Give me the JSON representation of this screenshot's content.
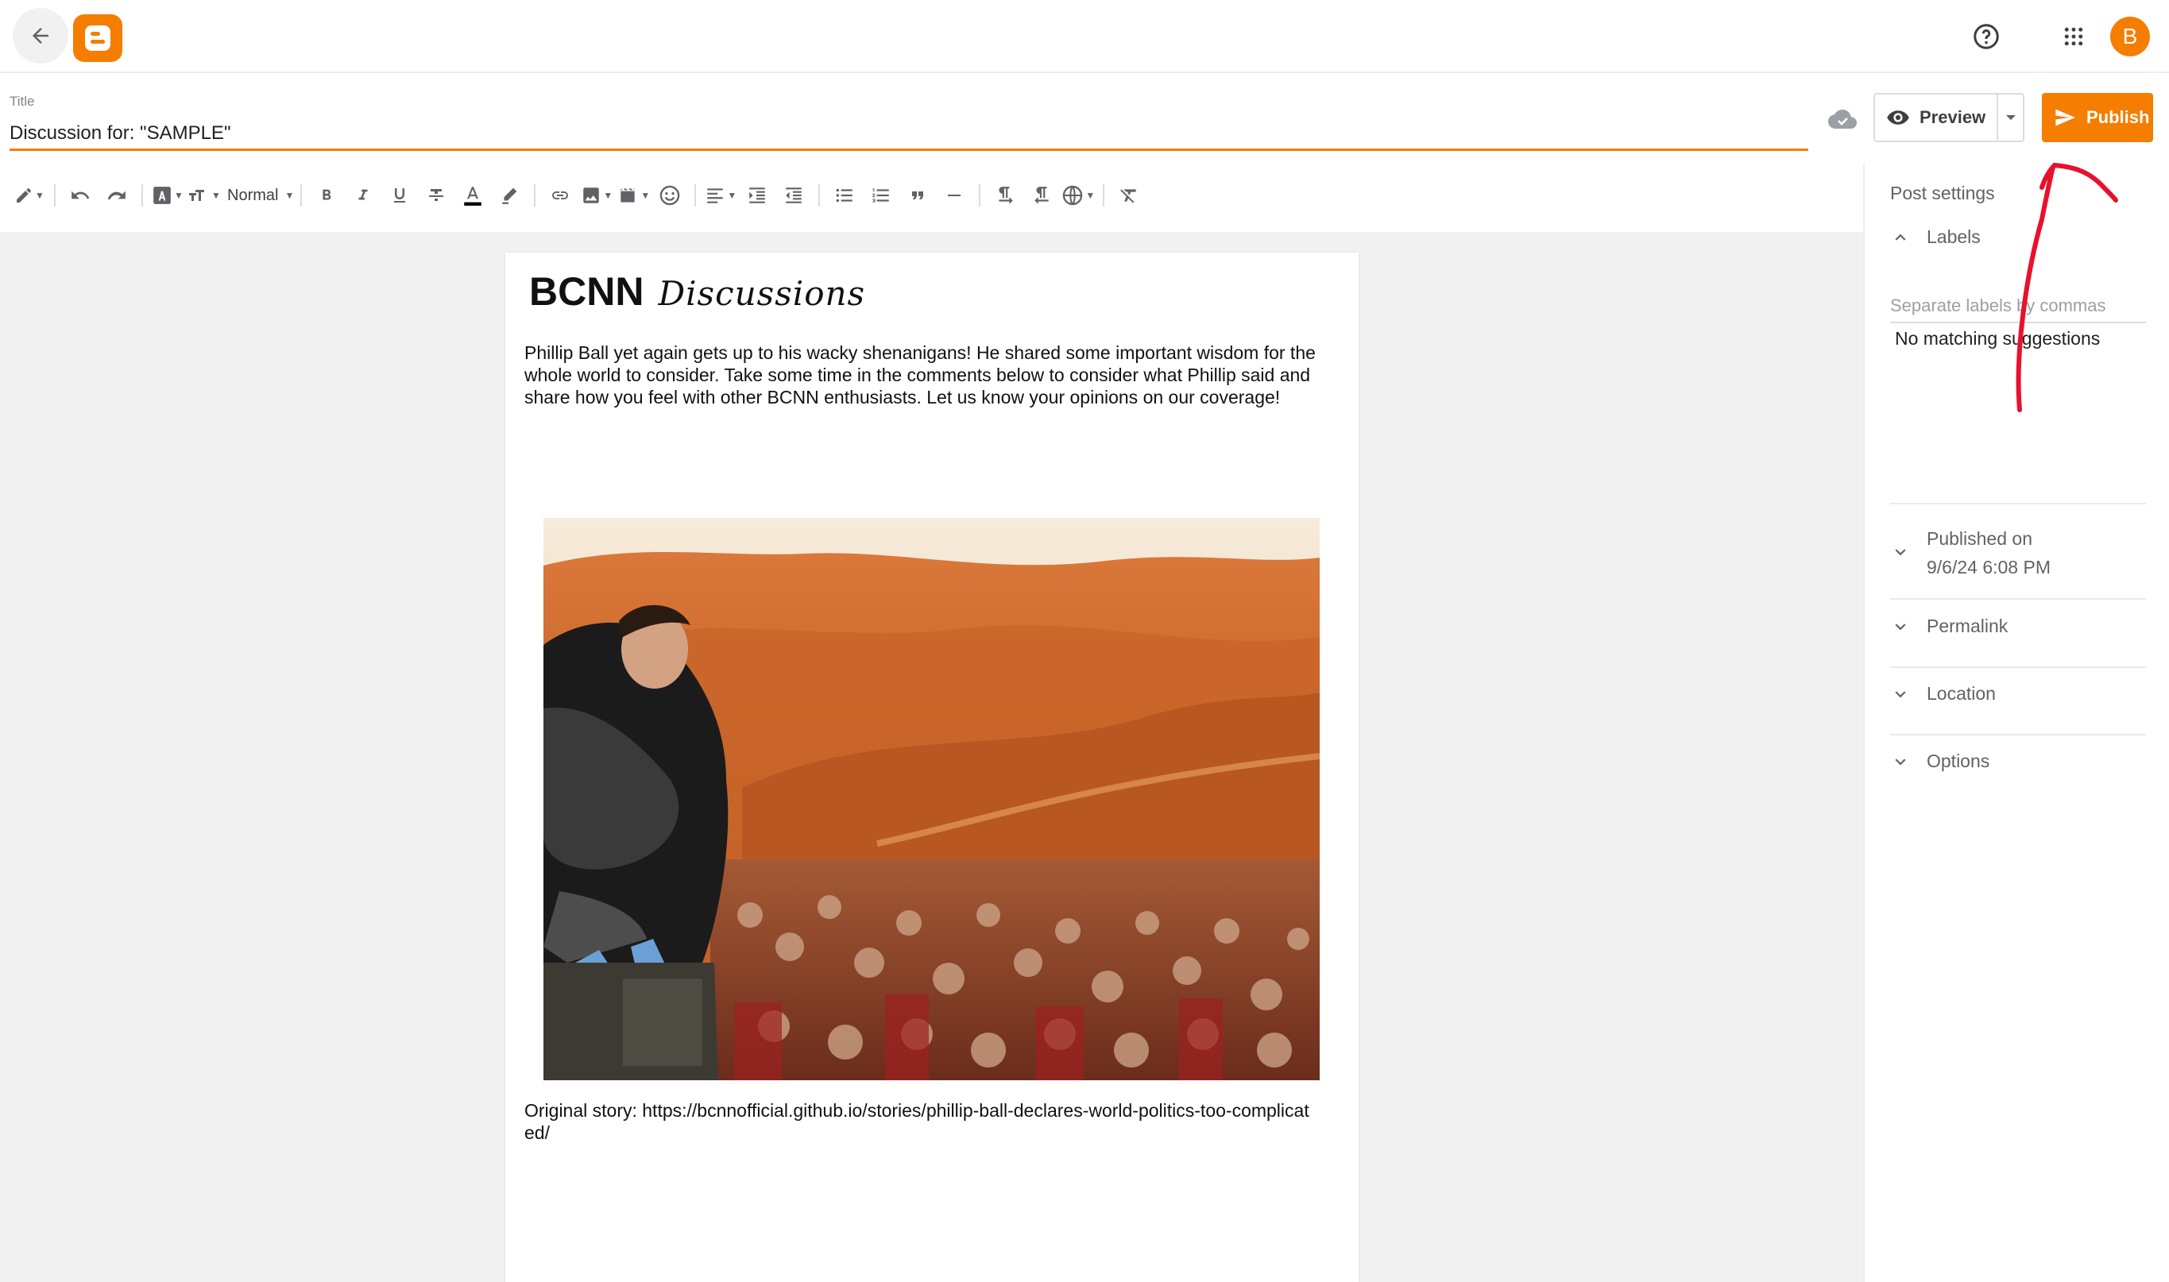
{
  "appbar": {
    "back_icon": "arrow-left-icon",
    "logo_icon": "blogger-logo-icon",
    "help_icon": "help-circle-icon",
    "apps_icon": "apps-grid-icon",
    "avatar_letter": "B",
    "brand_color": "#f57d00"
  },
  "title": {
    "label": "Title",
    "value": "Discussion for: \"SAMPLE\""
  },
  "actions": {
    "save_status_icon": "cloud-check-icon",
    "preview_label": "Preview",
    "preview_icon": "eye-icon",
    "preview_dropdown_icon": "caret-down-icon",
    "publish_label": "Publish",
    "publish_icon": "send-icon"
  },
  "toolbar": {
    "paragraph_style": "Normal",
    "tools": [
      "pencil-mode",
      "undo",
      "redo",
      "font-family",
      "font-size",
      "paragraph-style",
      "bold",
      "italic",
      "underline",
      "strikethrough",
      "text-color",
      "highlight",
      "link",
      "image",
      "video",
      "emoji",
      "align",
      "indent",
      "outdent",
      "bulleted-list",
      "numbered-list",
      "quote",
      "horizontal-rule",
      "ltr",
      "rtl",
      "language",
      "clear-formatting"
    ]
  },
  "post": {
    "heading_bold": "BCNN",
    "heading_script": "Discussions",
    "body": "Phillip Ball yet again gets up to his wacky shenanigans! He shared some important wisdom for the whole world to consider. Take some time in the comments below to consider what Phillip said and share how you feel with other BCNN enthusiasts. Let us know your opinions on our coverage!",
    "image_description": "collage-desert-dunes-man-crowd",
    "story": "Original story: https://bcnnofficial.github.io/stories/phillip-ball-declares-world-politics-too-complicated/"
  },
  "sidebar": {
    "title": "Post settings",
    "labels_title": "Labels",
    "labels_placeholder": "Separate labels by commas",
    "no_match": "No matching suggestions",
    "published_label": "Published on",
    "published_date": "9/6/24 6:08 PM",
    "permalink": "Permalink",
    "location": "Location",
    "options": "Options"
  },
  "annotation": {
    "color": "#e8112d",
    "type": "arrow-pointing-to-publish"
  }
}
